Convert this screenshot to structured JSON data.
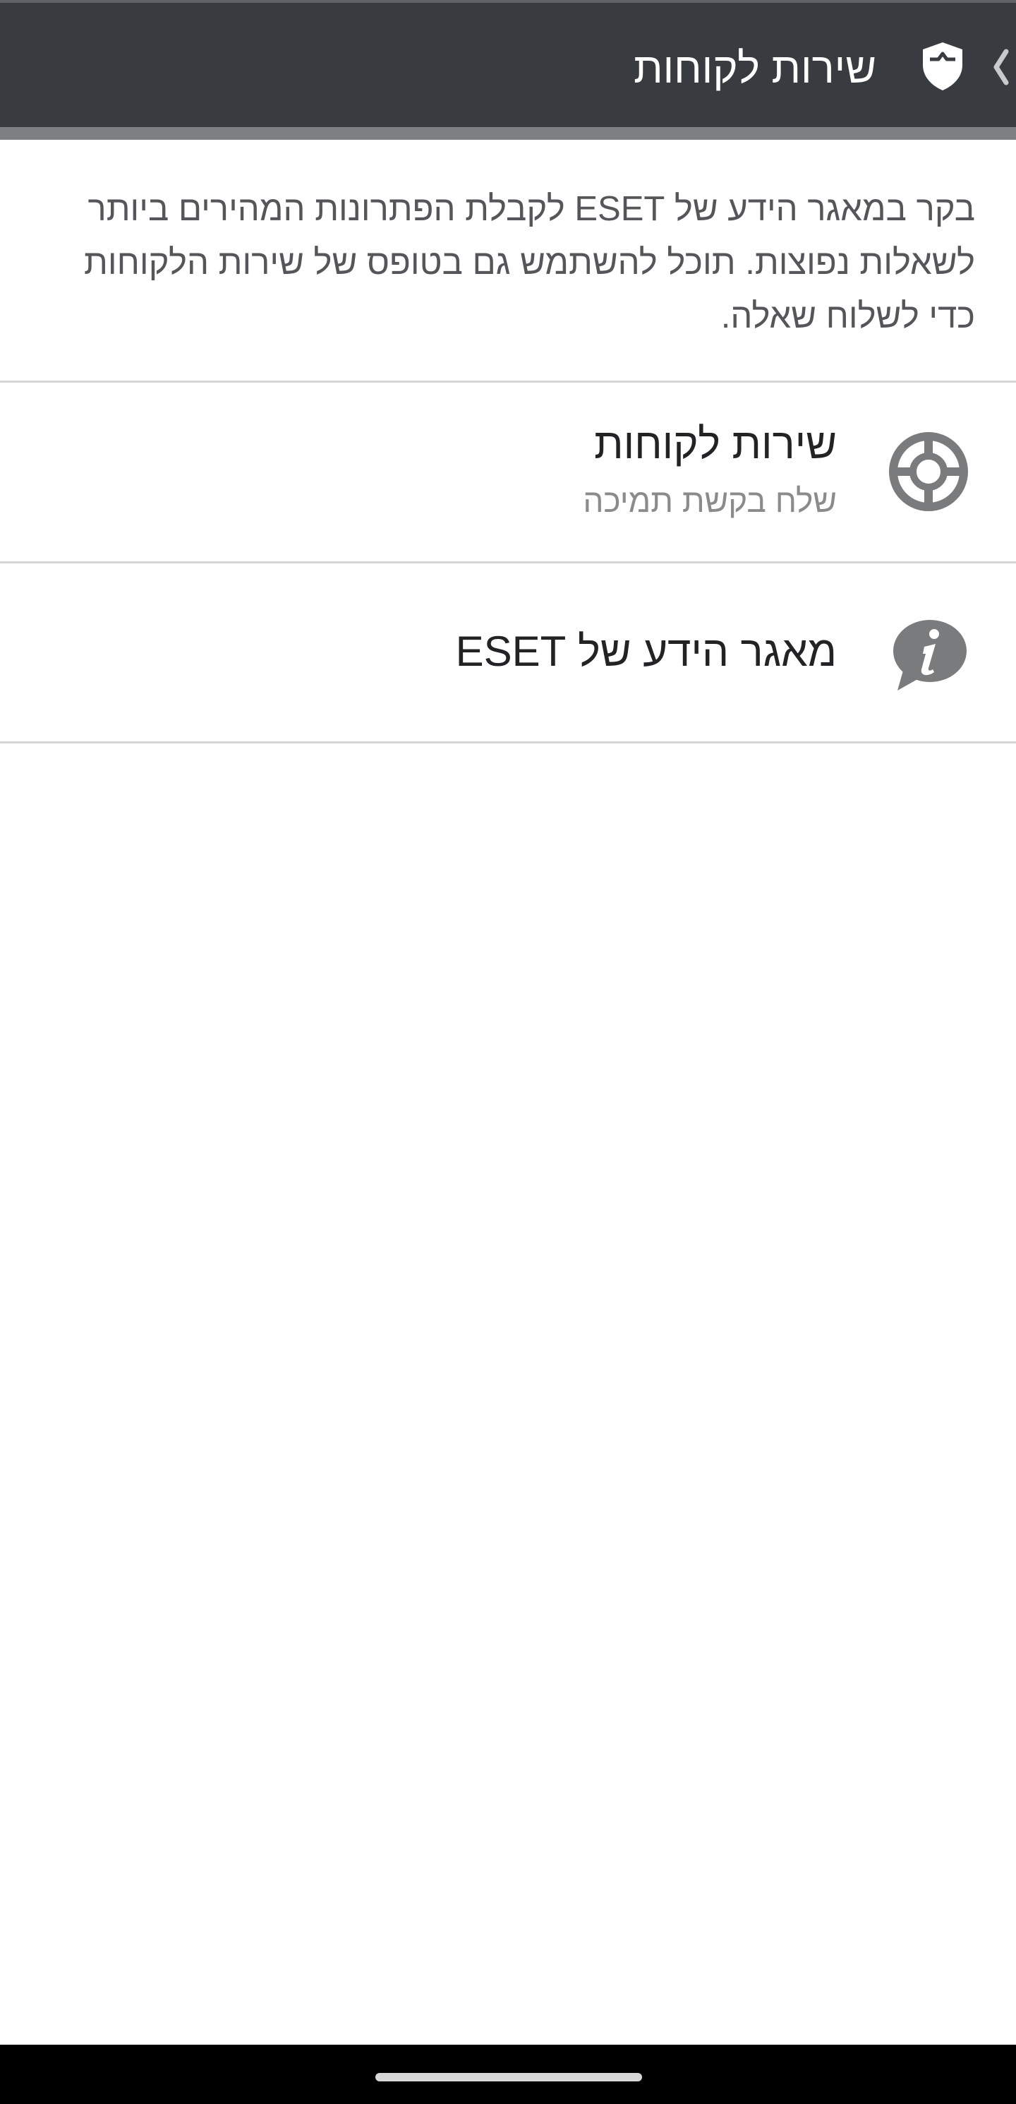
{
  "header": {
    "title": "שירות לקוחות",
    "back_icon": "chevron-left-icon",
    "logo_icon": "eset-shield-icon"
  },
  "intro_text": "בקר במאגר הידע של ESET לקבלת הפתרונות המהירים ביותר לשאלות נפוצות. תוכל להשתמש גם בטופס של שירות הלקוחות כדי לשלוח שאלה.",
  "items": [
    {
      "label": "שירות לקוחות",
      "sublabel": "שלח בקשת תמיכה",
      "icon": "lifebuoy-icon"
    },
    {
      "label": "מאגר הידע של ESET",
      "icon": "info-bubble-icon"
    }
  ],
  "colors": {
    "appbar": "#383c40",
    "icon_gray": "#7a7b7d",
    "text_primary": "#222325",
    "text_secondary": "#8a8b8d"
  }
}
